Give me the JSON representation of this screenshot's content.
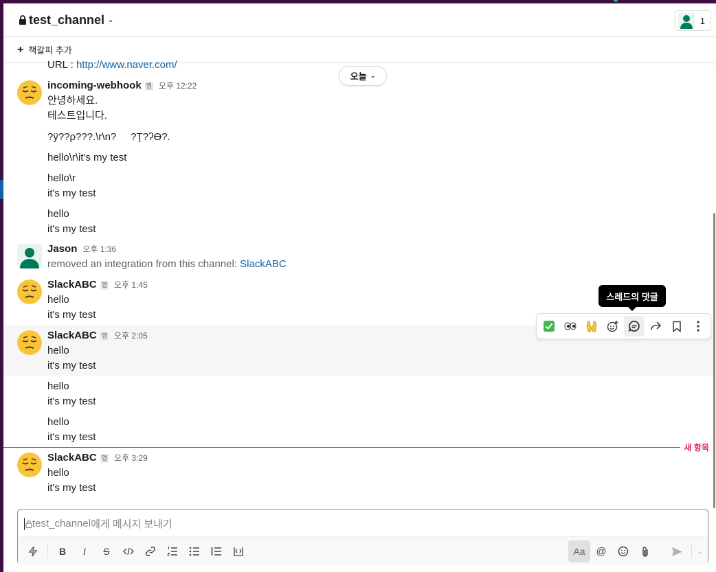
{
  "header": {
    "channel_name": "test_channel",
    "member_count": "1"
  },
  "bookmarks": {
    "add_label": "책갈피 추가"
  },
  "date_divider": "오늘",
  "messages": {
    "m0": {
      "url_text": "URL : ",
      "url_link": "http://www.naver.com/"
    },
    "m1": {
      "sender": "incoming-webhook",
      "badge": "앱",
      "time": "오후 12:22",
      "lines": [
        "안녕하세요.",
        "테스트입니다.",
        "?ÿ??ρ???.\\r\\n?     ?Ţ?ʔӨ?.",
        "hello\\r\\it's my test",
        "hello\\r",
        "it's my test",
        "hello",
        "it's my test"
      ]
    },
    "m2": {
      "sender": "Jason",
      "time": "오후 1:36",
      "text": "removed an integration from this channel: ",
      "link": "SlackABC"
    },
    "m3": {
      "sender": "SlackABC",
      "badge": "앱",
      "time": "오후 1:45",
      "lines": [
        "hello",
        "it's my test"
      ]
    },
    "m4": {
      "sender": "SlackABC",
      "badge": "앱",
      "time": "오후 2:05",
      "lines": [
        "hello",
        "it's my test",
        "hello",
        "it's my test",
        "hello",
        "it's my test"
      ]
    },
    "m5": {
      "sender": "SlackABC",
      "badge": "앱",
      "time": "오후 3:29",
      "lines": [
        "hello",
        "it's my test"
      ]
    }
  },
  "new_items_label": "새 항목",
  "hover_actions": {
    "tooltip": "스레드의 댓글",
    "items": [
      "white-check-mark-emoji",
      "eyes-emoji",
      "raised-hands-emoji",
      "add-reaction-icon",
      "reply-thread-icon",
      "share-icon",
      "bookmark-icon",
      "more-icon"
    ]
  },
  "composer": {
    "placeholder_channel": "test_channel",
    "placeholder_suffix": "에게 메시지 보내기",
    "format_label": "Aa"
  },
  "colors": {
    "sidebar": "#3f0e40",
    "link": "#1264a3",
    "new_divider": "#e01e5a"
  }
}
